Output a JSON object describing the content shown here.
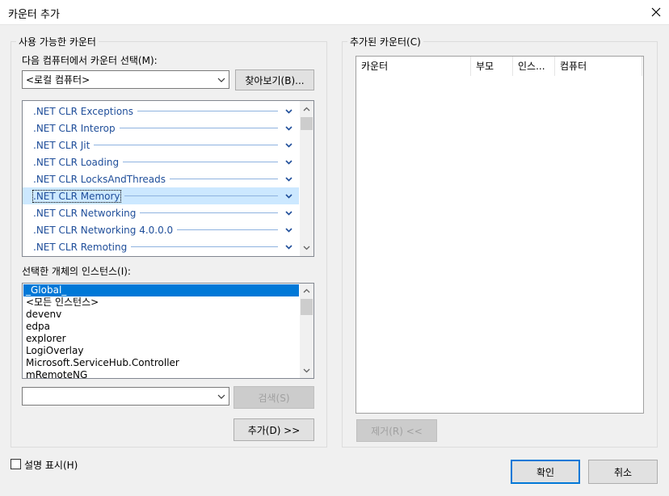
{
  "window": {
    "title": "카운터 추가"
  },
  "available": {
    "group_label": "사용 가능한 카운터",
    "computer_label": "다음 컴퓨터에서 카운터 선택(M):",
    "computer_value": "<로컬 컴퓨터>",
    "browse_button": "찾아보기(B)...",
    "objects": [
      ".NET CLR Exceptions",
      ".NET CLR Interop",
      ".NET CLR Jit",
      ".NET CLR Loading",
      ".NET CLR LocksAndThreads",
      ".NET CLR Memory",
      ".NET CLR Networking",
      ".NET CLR Networking 4.0.0.0",
      ".NET CLR Remoting"
    ],
    "selected_object": ".NET CLR Memory",
    "instances_label": "선택한 개체의 인스턴스(I):",
    "instances": [
      "_Global_",
      "<모든 인스턴스>",
      "devenv",
      "edpa",
      "explorer",
      "LogiOverlay",
      "Microsoft.ServiceHub.Controller",
      "mRemoteNG"
    ],
    "selected_instance": "_Global_",
    "search_value": "",
    "search_button": "검색(S)",
    "add_button": "추가(D) >>"
  },
  "added": {
    "group_label": "추가된 카운터(C)",
    "columns": [
      "카운터",
      "부모",
      "인스...",
      "컴퓨터"
    ],
    "remove_button": "제거(R) <<"
  },
  "footer": {
    "show_description": "설명 표시(H)",
    "show_description_checked": false,
    "ok_button": "확인",
    "cancel_button": "취소"
  },
  "colors": {
    "accent": "#0078d7",
    "selection_light": "#cce8ff",
    "object_text": "#1f4e9a"
  },
  "icons": {
    "close": "close-icon",
    "dropdown": "chevron-down-icon",
    "expand": "chevron-down-icon",
    "scroll_up": "scroll-up-arrow-icon",
    "scroll_down": "scroll-down-arrow-icon"
  }
}
